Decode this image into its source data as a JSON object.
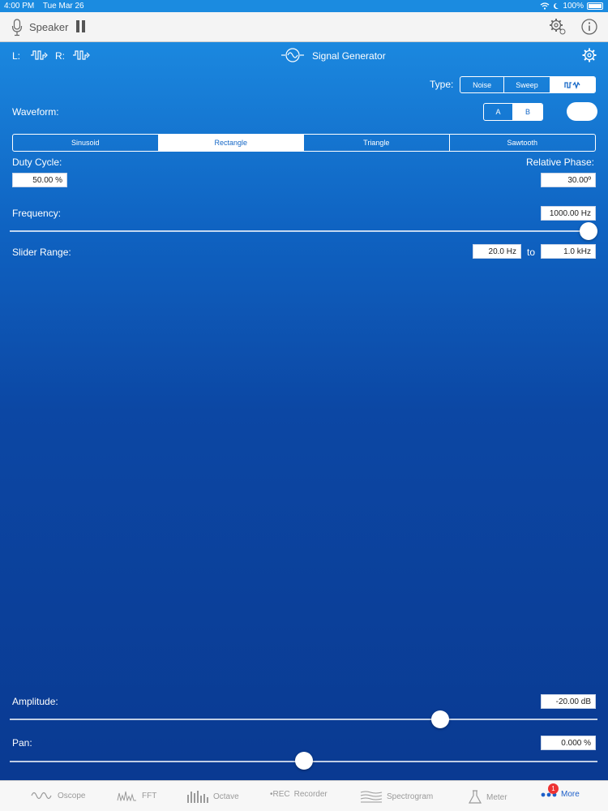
{
  "status": {
    "time": "4:00 PM",
    "date": "Tue Mar 26",
    "battery": "100%"
  },
  "header": {
    "input_label": "Speaker"
  },
  "toolbar": {
    "left_label": "L:",
    "right_label": "R:",
    "title": "Signal Generator"
  },
  "type": {
    "label": "Type:",
    "options": [
      "Noise",
      "Sweep"
    ]
  },
  "waveform": {
    "label": "Waveform:",
    "ab": [
      "A",
      "B"
    ],
    "selected_ab": "B",
    "options": [
      "Sinusoid",
      "Rectangle",
      "Triangle",
      "Sawtooth"
    ],
    "selected": "Rectangle"
  },
  "duty_cycle": {
    "label": "Duty Cycle:",
    "value": "50.00 %"
  },
  "relative_phase": {
    "label": "Relative Phase:",
    "value": "30.00º"
  },
  "frequency": {
    "label": "Frequency:",
    "value": "1000.00 Hz",
    "slider_position": 1.0
  },
  "slider_range": {
    "label": "Slider Range:",
    "min": "20.0 Hz",
    "to": "to",
    "max": "1.0 kHz"
  },
  "amplitude": {
    "label": "Amplitude:",
    "value": "-20.00 dB",
    "slider_position": 0.74
  },
  "pan": {
    "label": "Pan:",
    "value": "0.000 %",
    "slider_position": 0.5
  },
  "tabs": [
    {
      "label": "Oscope"
    },
    {
      "label": "FFT"
    },
    {
      "label": "Octave"
    },
    {
      "label": "Recorder",
      "prefix": "•REC"
    },
    {
      "label": "Spectrogram"
    },
    {
      "label": "Meter"
    },
    {
      "label": "More",
      "badge": "1",
      "active": true
    }
  ],
  "colors": {
    "accent": "#1d5fc9",
    "gradient_top": "#1b88df",
    "gradient_bottom": "#0a3a92"
  }
}
